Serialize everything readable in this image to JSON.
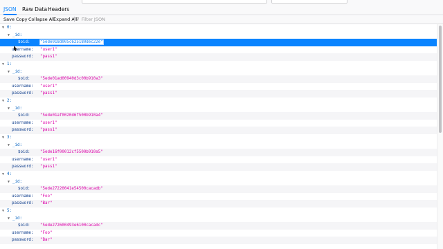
{
  "tabs": [
    {
      "label": "JSON",
      "active": true
    },
    {
      "label": "Raw Data",
      "active": false
    },
    {
      "label": "Headers",
      "active": false
    }
  ],
  "toolbar": {
    "save_label": "Save",
    "copy_label": "Copy",
    "collapse_label": "Collapse All",
    "expand_label": "Expand All",
    "filter_placeholder": "Filter JSON"
  },
  "records": [
    {
      "index": "0:",
      "oid": "\"5ede018d005c625180dec22e\"",
      "username": "\"user1\"",
      "password": "\"pass1\""
    },
    {
      "index": "1:",
      "oid": "\"5ede01ad00940d3c00b910a3\"",
      "username": "\"user1\"",
      "password": "\"pass1\""
    },
    {
      "index": "2:",
      "oid": "\"5ede01af0020d6f500b910a4\"",
      "username": "\"user1\"",
      "password": "\"pass1\""
    },
    {
      "index": "3:",
      "oid": "\"5ede16f00012cf5500b910a5\"",
      "username": "\"user1\"",
      "password": "\"pass1\""
    },
    {
      "index": "4:",
      "oid": "\"5ede27220041e54500cacadb\"",
      "username": "\"Foo\"",
      "password": "\"Bar\""
    },
    {
      "index": "5:",
      "oid": "\"5ede272600493e6100cacadc\"",
      "username": "\"Foo\"",
      "password": "\"Bar\""
    }
  ],
  "keys": {
    "id": "_id:",
    "oid": "$oid:",
    "username": "username:",
    "password": "password:"
  },
  "colors": {
    "accent": "#0a84ff",
    "string_value": "#dd00a9",
    "key": "#0060c0"
  }
}
